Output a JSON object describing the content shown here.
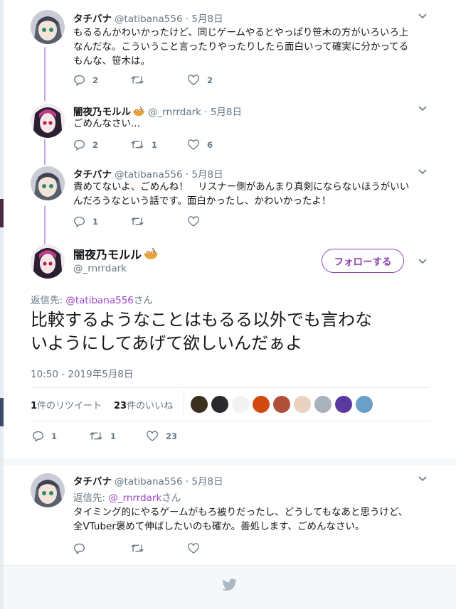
{
  "tweets": [
    {
      "name": "タチバナ",
      "meta": "@tatibana556 · 5月8日",
      "text_lines": [
        "もるるんかわいかったけど、同じゲームやるとやっぱり笹木の方がいろいろ上",
        "なんだな。こういうこと言ったりやったりしたら面白いって確実に分かってる",
        "もんな、笹木は。"
      ],
      "replies": "2",
      "retweets": "",
      "likes": "2"
    },
    {
      "name": "闇夜乃モルル",
      "meta": "@_rnrrdark · 5月8日",
      "text_lines": [
        "ごめんなさい..."
      ],
      "replies": "2",
      "retweets": "1",
      "likes": "6"
    },
    {
      "name": "タチバナ",
      "meta": "@tatibana556 · 5月8日",
      "text_lines": [
        "責めてないよ、ごめんね！　リスナー側があんまり真剣にならないほうがいい",
        "んだろうなという話です。面白かったし、かわいかったよ！"
      ],
      "replies": "1",
      "retweets": "",
      "likes": ""
    }
  ],
  "focus": {
    "name": "闇夜乃モルル",
    "handle": "@_rnrrdark",
    "follow_label": "フォローする",
    "reply_prefix": "返信先: ",
    "reply_to": "@tatibana556",
    "reply_suffix": "さん",
    "text_lines": [
      "比較するようなことはもるる以外でも言わな",
      "いようにしてあげて欲しいんだぁよ"
    ],
    "timestamp": "10:50 - 2019年5月8日",
    "stats": {
      "retweet_count": "1",
      "retweet_label": "件のリツイート",
      "like_count": "23",
      "like_label": "件のいいね"
    },
    "replies": "1",
    "retweets": "1",
    "likes": "23"
  },
  "reply": {
    "name": "タチバナ",
    "meta": "@tatibana556 · 5月8日",
    "reply_prefix": "返信先: ",
    "reply_to": "@_rnrrdark",
    "reply_suffix": "さん",
    "text_lines": [
      "タイミング的にやるゲームがもろ被りだったし、どうしてもなあと思うけど、",
      "全VTuber褒めて伸ばしたいのも確か。善処します、ごめんなさい。"
    ],
    "replies": "",
    "retweets": "",
    "likes": ""
  },
  "icons": {
    "reply": "reply-icon",
    "retweet": "retweet-icon",
    "like": "heart-icon",
    "caret": "chevron-down-icon",
    "footer": "twitter-bird-icon",
    "bowl": "ramen-emoji"
  },
  "colors": {
    "accent": "#8e44ad",
    "thread_line": "#c9a6e6",
    "gray": "#657786",
    "twitter_blue": "#1da1f2"
  }
}
